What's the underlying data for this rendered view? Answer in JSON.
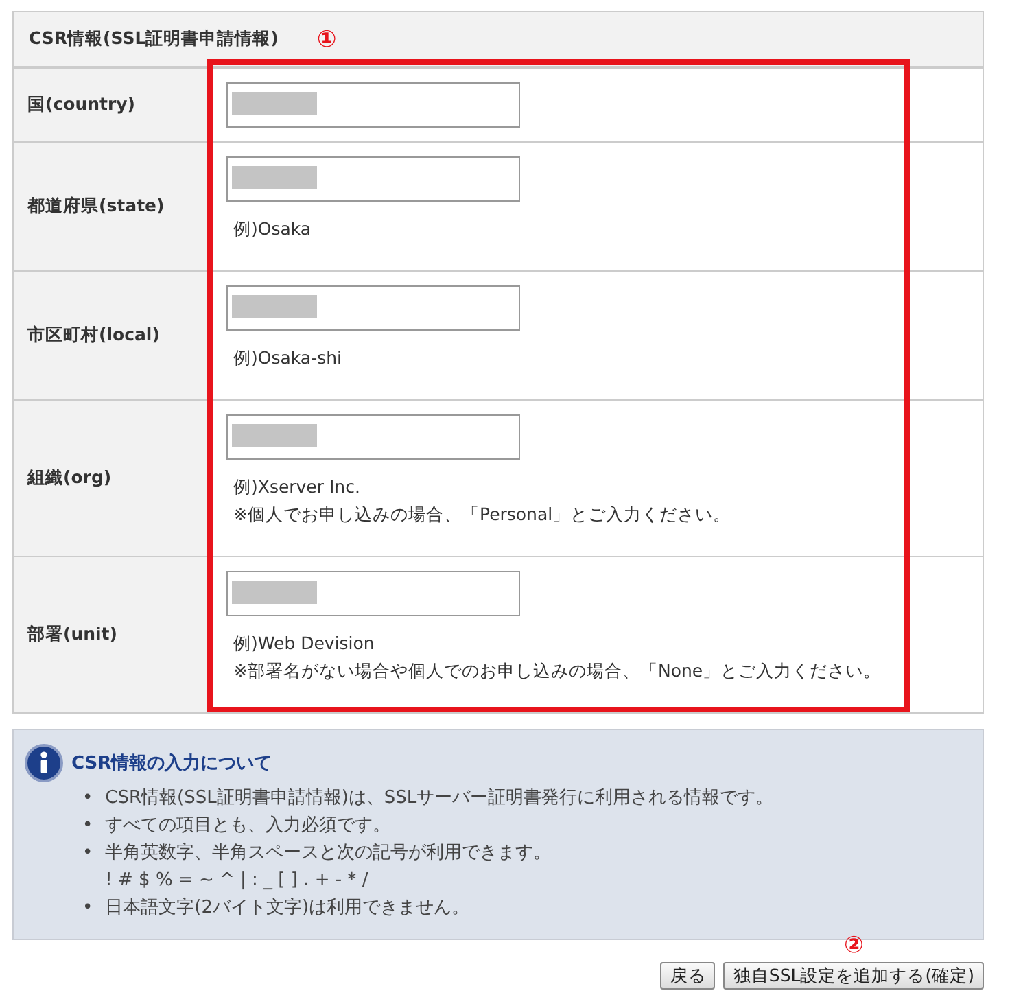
{
  "form": {
    "title": "CSR情報(SSL証明書申請情報)",
    "marker": "①",
    "rows": [
      {
        "label": "国(country)",
        "redacted": true,
        "hints": []
      },
      {
        "label": "都道府県(state)",
        "redacted": true,
        "hints": [
          "例)Osaka"
        ]
      },
      {
        "label": "市区町村(local)",
        "redacted": true,
        "hints": [
          "例)Osaka-shi"
        ]
      },
      {
        "label": "組織(org)",
        "redacted": true,
        "hints": [
          "例)Xserver Inc.",
          "※個人でお申し込みの場合、「Personal」とご入力ください。"
        ]
      },
      {
        "label": "部署(unit)",
        "redacted": true,
        "hints": [
          "例)Web Devision",
          "※部署名がない場合や個人でのお申し込みの場合、「None」とご入力ください。"
        ]
      }
    ]
  },
  "info": {
    "title": "CSR情報の入力について",
    "items": [
      {
        "bullet": "•",
        "text": "CSR情報(SSL証明書申請情報)は、SSLサーバー証明書発行に利用される情報です。"
      },
      {
        "bullet": "•",
        "text": "すべての項目とも、入力必須です。"
      },
      {
        "bullet": "•",
        "text": "半角英数字、半角スペースと次の記号が利用できます。",
        "extra": "! # $ % = ~ ^ | : _ [ ] . + - * /"
      },
      {
        "bullet": "•",
        "text": "日本語文字(2バイト文字)は利用できません。"
      }
    ]
  },
  "buttons": [
    {
      "label": "戻る"
    },
    {
      "label": "独自SSL設定を追加する(確定)",
      "marker": "②"
    }
  ]
}
